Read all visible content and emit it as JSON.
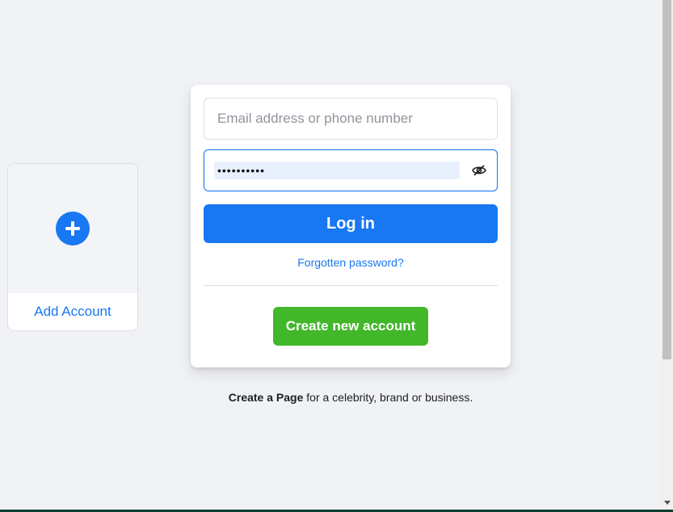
{
  "add_account": {
    "label": "Add Account",
    "icon": "plus-circle-icon"
  },
  "login": {
    "email_placeholder": "Email address or phone number",
    "email_value": "",
    "password_value": "••••••••••",
    "show_password_icon": "eye-slash-icon",
    "login_label": "Log in",
    "forgot_label": "Forgotten password?",
    "create_label": "Create new account"
  },
  "footer": {
    "create_page_link": "Create a Page",
    "create_page_text": " for a celebrity, brand or business."
  },
  "colors": {
    "primary": "#1877f2",
    "success": "#42b72a",
    "background": "#f0f2f5"
  }
}
